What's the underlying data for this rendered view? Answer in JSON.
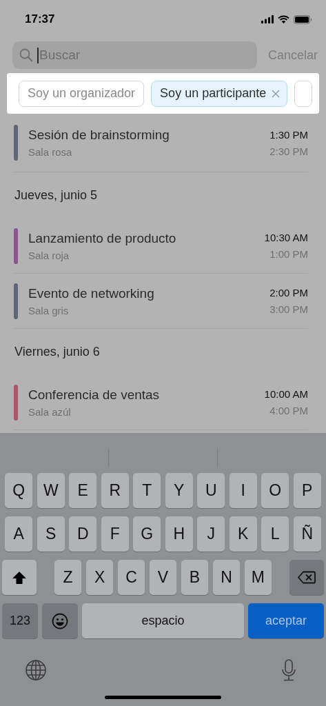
{
  "status_bar": {
    "time": "17:37"
  },
  "search": {
    "placeholder": "Buscar",
    "cancel": "Cancelar"
  },
  "filters": [
    {
      "label": "Soy un organizador",
      "selected": false
    },
    {
      "label": "Soy un participante",
      "selected": true
    },
    {
      "selected": false
    }
  ],
  "agenda": [
    {
      "kind": "event",
      "title": "Sesión de brainstorming",
      "room": "Sala rosa",
      "start": "1:30 PM",
      "end": "2:30 PM",
      "color": "#5f6675"
    },
    {
      "kind": "header",
      "text": "Jueves, junio 5"
    },
    {
      "kind": "event",
      "title": "Lanzamiento de producto",
      "room": "Sala roja",
      "start": "10:30 AM",
      "end": "1:00 PM",
      "color": "#8c5592"
    },
    {
      "kind": "event",
      "title": "Evento de networking",
      "room": "Sala gris",
      "start": "2:00 PM",
      "end": "3:00 PM",
      "color": "#5f6675"
    },
    {
      "kind": "header",
      "text": "Viernes, junio 6"
    },
    {
      "kind": "event",
      "title": "Conferencia de ventas",
      "room": "Sala azúl",
      "start": "10:00 AM",
      "end": "4:00 PM",
      "color": "#b05468"
    }
  ],
  "keyboard": {
    "rows": [
      {
        "keys": [
          {
            "kind": "letter",
            "label": "Q"
          },
          {
            "kind": "letter",
            "label": "W"
          },
          {
            "kind": "letter",
            "label": "E"
          },
          {
            "kind": "letter",
            "label": "R"
          },
          {
            "kind": "letter",
            "label": "T"
          },
          {
            "kind": "letter",
            "label": "Y"
          },
          {
            "kind": "letter",
            "label": "U"
          },
          {
            "kind": "letter",
            "label": "I"
          },
          {
            "kind": "letter",
            "label": "O"
          },
          {
            "kind": "letter",
            "label": "P"
          }
        ]
      },
      {
        "keys": [
          {
            "kind": "letter",
            "label": "A"
          },
          {
            "kind": "letter",
            "label": "S"
          },
          {
            "kind": "letter",
            "label": "D"
          },
          {
            "kind": "letter",
            "label": "F"
          },
          {
            "kind": "letter",
            "label": "G"
          },
          {
            "kind": "letter",
            "label": "H"
          },
          {
            "kind": "letter",
            "label": "J"
          },
          {
            "kind": "letter",
            "label": "K"
          },
          {
            "kind": "letter",
            "label": "L"
          },
          {
            "kind": "letter",
            "label": "Ñ"
          }
        ]
      },
      {
        "keys": [
          {
            "kind": "shift"
          },
          {
            "kind": "letter",
            "label": "Z"
          },
          {
            "kind": "letter",
            "label": "X"
          },
          {
            "kind": "letter",
            "label": "C"
          },
          {
            "kind": "letter",
            "label": "V"
          },
          {
            "kind": "letter",
            "label": "B"
          },
          {
            "kind": "letter",
            "label": "N"
          },
          {
            "kind": "letter",
            "label": "M"
          },
          {
            "kind": "delete"
          }
        ]
      },
      {
        "keys": [
          {
            "kind": "numbers",
            "label": "123"
          },
          {
            "kind": "emoji"
          },
          {
            "kind": "space",
            "label": "espacio"
          },
          {
            "kind": "return",
            "label": "aceptar"
          }
        ]
      }
    ]
  }
}
